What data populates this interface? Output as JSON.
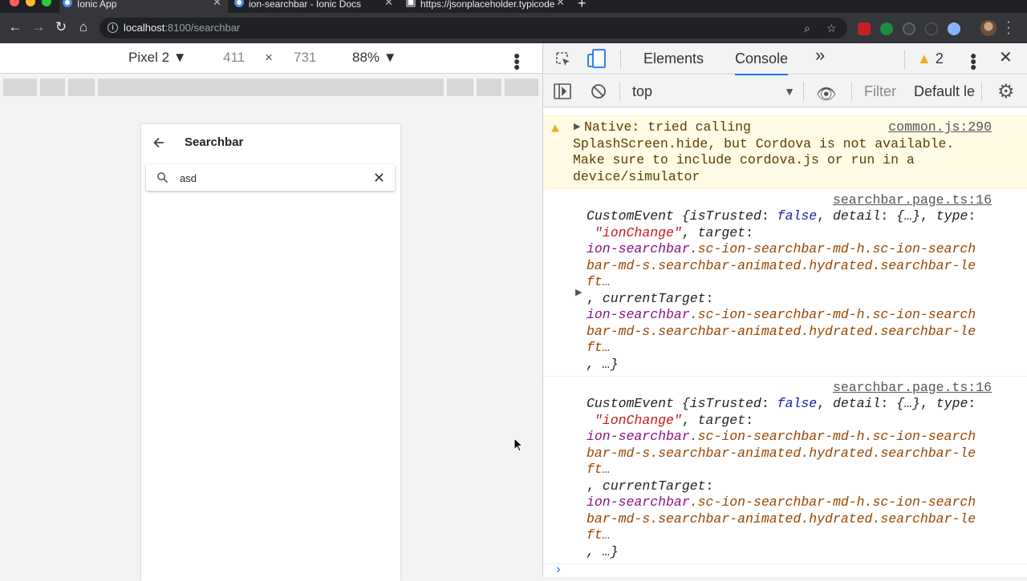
{
  "browser": {
    "tabs": [
      {
        "title": "Ionic App",
        "active": true
      },
      {
        "title": "ion-searchbar - Ionic Docs",
        "active": false
      },
      {
        "title": "https://jsonplaceholder.typicode",
        "active": false
      }
    ],
    "url_host": "localhost",
    "url_path": ":8100/searchbar"
  },
  "device_toolbar": {
    "device": "Pixel 2",
    "width": "411",
    "times": "×",
    "height": "731",
    "zoom": "88%"
  },
  "app": {
    "title": "Searchbar",
    "search_value": "asd"
  },
  "devtools": {
    "tab_elements": "Elements",
    "tab_console": "Console",
    "more_tabs": "»",
    "warning_count": "2",
    "context": "top",
    "filter_placeholder": "Filter",
    "levels": "Default le"
  },
  "console": {
    "warning": {
      "text": "Native: tried calling\nSplashScreen.hide, but Cordova is not available.\nMake sure to include cordova.js or run in a\ndevice/simulator",
      "source": "common.js:290"
    },
    "logs": [
      {
        "source": "searchbar.page.ts:16",
        "line1_a": "CustomEvent {",
        "k_istrusted": "isTrusted",
        "v_istrusted": "false",
        "k_detail": "detail",
        "v_detail": "{…}",
        "k_type": "type",
        "v_type": "\"ionChange\"",
        "k_target": "target",
        "el_tag": "ion-searchbar",
        "el_class_1": ".sc-ion-searchbar-md-h.sc-ion-search",
        "el_class_2": "bar-md-s.searchbar-animated.hydrated.searchbar-le",
        "el_class_3": "ft…",
        "k_currenttarget": "currentTarget",
        "el2_tag": "ion-searchbar",
        "el2_class_1": ".sc-ion-searchbar-md-h.sc-ion-search",
        "el2_class_2": "bar-md-s.searchbar-animated.hydrated.searchbar-le",
        "el2_class_3": "ft…",
        "tail": ", …}"
      },
      {
        "source": "searchbar.page.ts:16",
        "line1_a": "CustomEvent {",
        "k_istrusted": "isTrusted",
        "v_istrusted": "false",
        "k_detail": "detail",
        "v_detail": "{…}",
        "k_type": "type",
        "v_type": "\"ionChange\"",
        "k_target": "target",
        "el_tag": "ion-searchbar",
        "el_class_1": ".sc-ion-searchbar-md-h.sc-ion-search",
        "el_class_2": "bar-md-s.searchbar-animated.hydrated.searchbar-le",
        "el_class_3": "ft…",
        "k_currenttarget": "currentTarget",
        "el2_tag": "ion-searchbar",
        "el2_class_1": ".sc-ion-searchbar-md-h.sc-ion-search",
        "el2_class_2": "bar-md-s.searchbar-animated.hydrated.searchbar-le",
        "el2_class_3": "ft…",
        "tail": ", …}"
      }
    ]
  },
  "colors": {
    "accent": "#1a73e8",
    "warning_bg": "#fffbe5",
    "warning_icon": "#f2ab26"
  }
}
